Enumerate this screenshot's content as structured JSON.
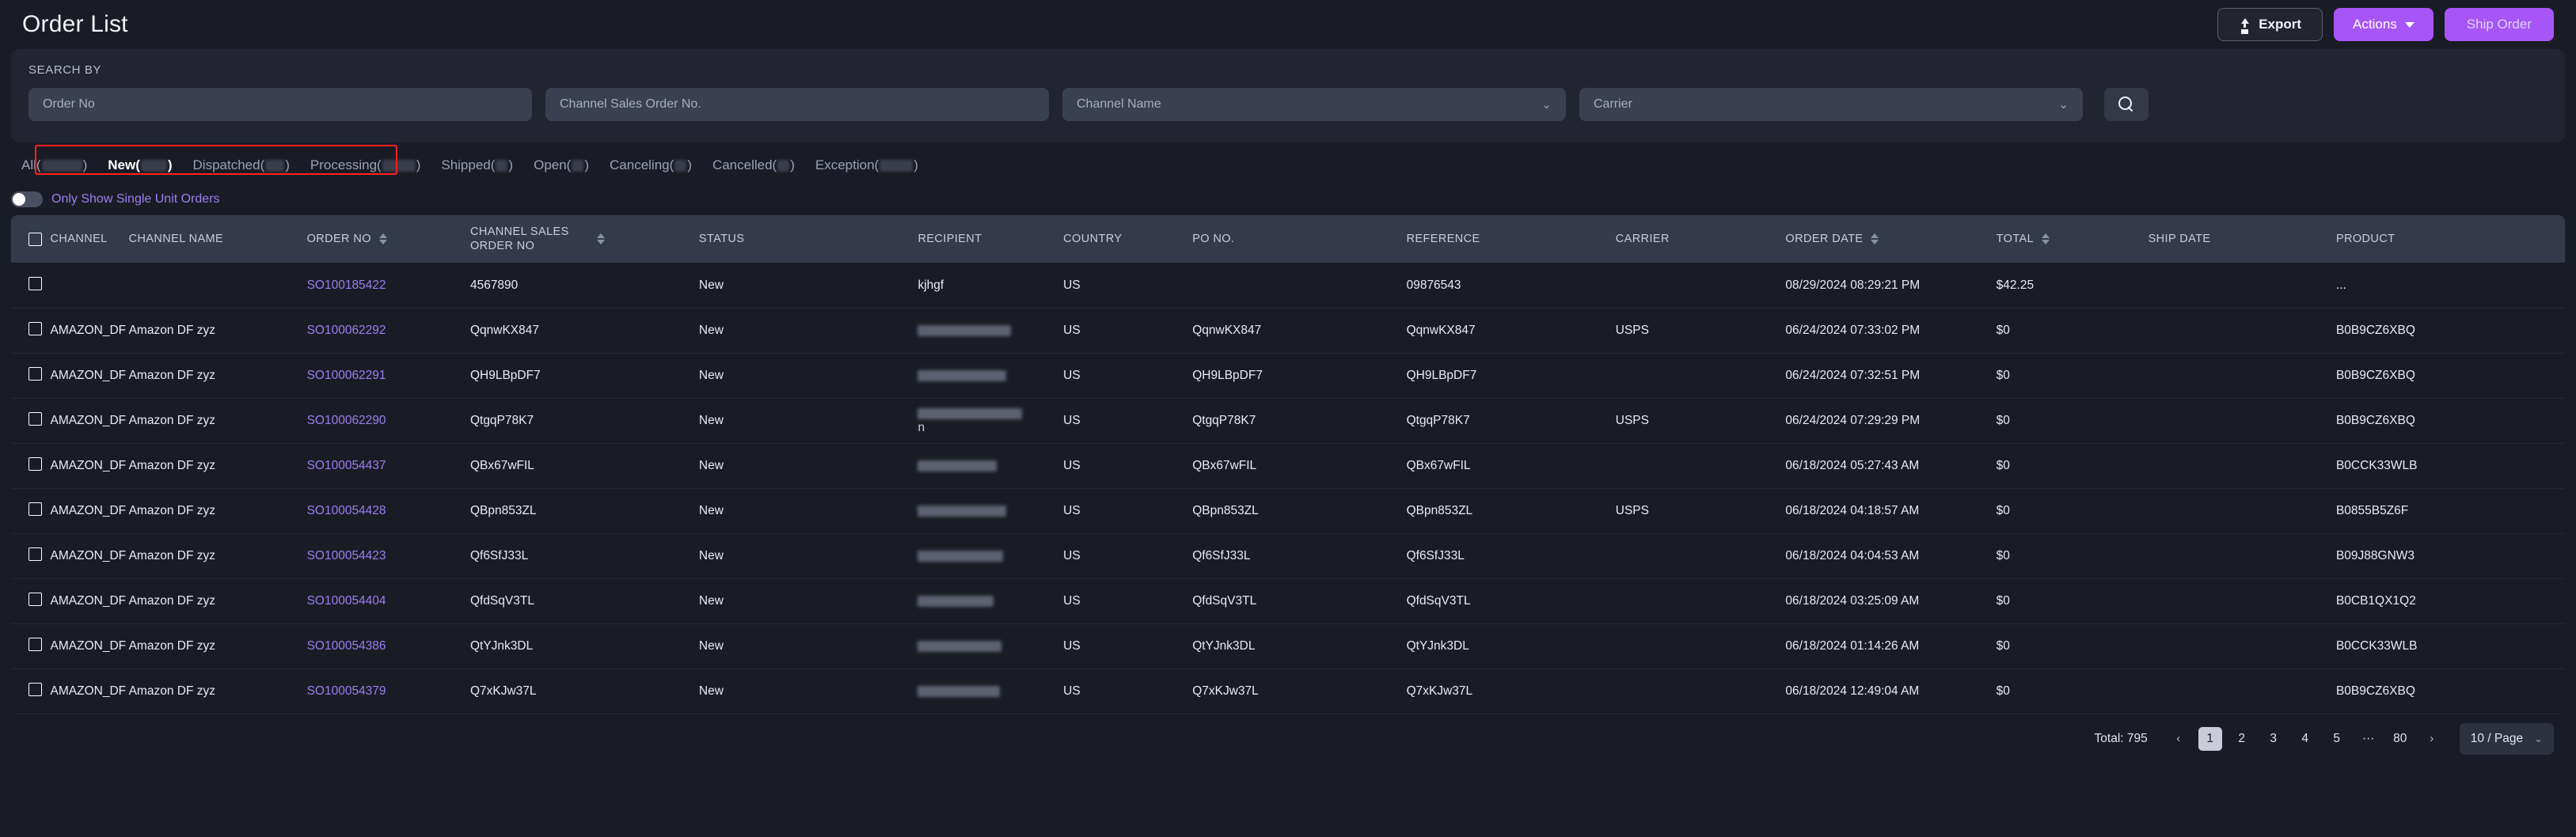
{
  "header": {
    "title": "Order List",
    "export_label": "Export",
    "actions_label": "Actions",
    "ship_label": "Ship Order",
    "export_icon": "upload-icon",
    "actions_icon": "chevron-down-icon"
  },
  "search": {
    "section_label": "SEARCH BY",
    "order_no_placeholder": "Order No",
    "order_no_value": "",
    "channel_sales_order_no_placeholder": "Channel Sales Order No.",
    "channel_sales_order_no_value": "",
    "channel_name_placeholder": "Channel Name",
    "carrier_placeholder": "Carrier",
    "search_icon": "search-icon",
    "chevron": "⌄"
  },
  "tabs": {
    "active": "New",
    "items": [
      {
        "label": "All(",
        "count": "█████",
        "suffix": ")",
        "count_redacted": true,
        "active": false
      },
      {
        "label": "New(",
        "count": "███",
        "suffix": ")",
        "count_redacted": true,
        "active": true
      },
      {
        "label": "Dispatched(",
        "count": "██",
        "suffix": ")",
        "count_redacted": true,
        "active": false
      },
      {
        "label": "Processing(",
        "count": "████",
        "suffix": ")",
        "count_redacted": true,
        "active": false
      },
      {
        "label": "Shipped(",
        "count": "█",
        "suffix": ")",
        "count_redacted": true,
        "active": false
      },
      {
        "label": "Open(",
        "count": "█",
        "suffix": ")",
        "count_redacted": true,
        "active": false
      },
      {
        "label": "Canceling(",
        "count": "█",
        "suffix": ")",
        "count_redacted": true,
        "active": false
      },
      {
        "label": "Cancelled(",
        "count": "█",
        "suffix": ")",
        "count_redacted": true,
        "active": false
      },
      {
        "label": "Exception(",
        "count": "████",
        "suffix": ")",
        "count_redacted": true,
        "active": false
      }
    ],
    "highlight_color": "#fe2020"
  },
  "toggle": {
    "label": "Only Show Single Unit Orders",
    "checked": false
  },
  "table": {
    "columns": [
      {
        "key": "checkbox",
        "label": "",
        "sortable": false
      },
      {
        "key": "channel",
        "label": "CHANNEL",
        "sortable": false
      },
      {
        "key": "cname",
        "label": "CHANNEL NAME",
        "sortable": false
      },
      {
        "key": "order_no",
        "label": "ORDER NO",
        "sortable": true
      },
      {
        "key": "cso_no",
        "label": "CHANNEL SALES ORDER NO",
        "sortable": true
      },
      {
        "key": "status",
        "label": "STATUS",
        "sortable": false
      },
      {
        "key": "recipient",
        "label": "RECIPIENT",
        "sortable": false
      },
      {
        "key": "country",
        "label": "COUNTRY",
        "sortable": false
      },
      {
        "key": "po_no",
        "label": "PO NO.",
        "sortable": false
      },
      {
        "key": "reference",
        "label": "REFERENCE",
        "sortable": false
      },
      {
        "key": "carrier",
        "label": "CARRIER",
        "sortable": false
      },
      {
        "key": "order_date",
        "label": "ORDER DATE",
        "sortable": true
      },
      {
        "key": "total",
        "label": "TOTAL",
        "sortable": true
      },
      {
        "key": "ship_date",
        "label": "SHIP DATE",
        "sortable": false
      },
      {
        "key": "product",
        "label": "PRODUCT",
        "sortable": false
      }
    ],
    "rows": [
      {
        "selected": false,
        "channel": "",
        "cname": "",
        "order_no": "SO100185422",
        "cso_no": "4567890",
        "status": "New",
        "recipient": "kjhgf",
        "recipient_redacted": false,
        "country": "US",
        "po_no": "",
        "reference": "09876543",
        "carrier": "",
        "order_date": "08/29/2024 08:29:21 PM",
        "total": "$42.25",
        "ship_date": "",
        "product": "..."
      },
      {
        "selected": false,
        "channel": "AMAZON_DF",
        "cname": "Amazon DF zyz",
        "order_no": "SO100062292",
        "cso_no": "QqnwKX847",
        "status": "New",
        "recipient": "",
        "recipient_redacted": true,
        "country": "US",
        "po_no": "QqnwKX847",
        "reference": "QqnwKX847",
        "carrier": "USPS",
        "order_date": "06/24/2024 07:33:02 PM",
        "total": "$0",
        "ship_date": "",
        "product": "B0B9CZ6XBQ"
      },
      {
        "selected": false,
        "channel": "AMAZON_DF",
        "cname": "Amazon DF zyz",
        "order_no": "SO100062291",
        "cso_no": "QH9LBpDF7",
        "status": "New",
        "recipient": "",
        "recipient_redacted": true,
        "country": "US",
        "po_no": "QH9LBpDF7",
        "reference": "QH9LBpDF7",
        "carrier": "",
        "order_date": "06/24/2024 07:32:51 PM",
        "total": "$0",
        "ship_date": "",
        "product": "B0B9CZ6XBQ"
      },
      {
        "selected": false,
        "channel": "AMAZON_DF",
        "cname": "Amazon DF zyz",
        "order_no": "SO100062290",
        "cso_no": "QtgqP78K7",
        "status": "New",
        "recipient": "n",
        "recipient_redacted": true,
        "country": "US",
        "po_no": "QtgqP78K7",
        "reference": "QtgqP78K7",
        "carrier": "USPS",
        "order_date": "06/24/2024 07:29:29 PM",
        "total": "$0",
        "ship_date": "",
        "product": "B0B9CZ6XBQ"
      },
      {
        "selected": false,
        "channel": "AMAZON_DF",
        "cname": "Amazon DF zyz",
        "order_no": "SO100054437",
        "cso_no": "QBx67wFIL",
        "status": "New",
        "recipient": "",
        "recipient_redacted": true,
        "country": "US",
        "po_no": "QBx67wFIL",
        "reference": "QBx67wFIL",
        "carrier": "",
        "order_date": "06/18/2024 05:27:43 AM",
        "total": "$0",
        "ship_date": "",
        "product": "B0CCK33WLB"
      },
      {
        "selected": false,
        "channel": "AMAZON_DF",
        "cname": "Amazon DF zyz",
        "order_no": "SO100054428",
        "cso_no": "QBpn853ZL",
        "status": "New",
        "recipient": "",
        "recipient_redacted": true,
        "country": "US",
        "po_no": "QBpn853ZL",
        "reference": "QBpn853ZL",
        "carrier": "USPS",
        "order_date": "06/18/2024 04:18:57 AM",
        "total": "$0",
        "ship_date": "",
        "product": "B0855B5Z6F"
      },
      {
        "selected": false,
        "channel": "AMAZON_DF",
        "cname": "Amazon DF zyz",
        "order_no": "SO100054423",
        "cso_no": "Qf6SfJ33L",
        "status": "New",
        "recipient": "",
        "recipient_redacted": true,
        "country": "US",
        "po_no": "Qf6SfJ33L",
        "reference": "Qf6SfJ33L",
        "carrier": "",
        "order_date": "06/18/2024 04:04:53 AM",
        "total": "$0",
        "ship_date": "",
        "product": "B09J88GNW3"
      },
      {
        "selected": false,
        "channel": "AMAZON_DF",
        "cname": "Amazon DF zyz",
        "order_no": "SO100054404",
        "cso_no": "QfdSqV3TL",
        "status": "New",
        "recipient": "",
        "recipient_redacted": true,
        "country": "US",
        "po_no": "QfdSqV3TL",
        "reference": "QfdSqV3TL",
        "carrier": "",
        "order_date": "06/18/2024 03:25:09 AM",
        "total": "$0",
        "ship_date": "",
        "product": "B0CB1QX1Q2"
      },
      {
        "selected": false,
        "channel": "AMAZON_DF",
        "cname": "Amazon DF zyz",
        "order_no": "SO100054386",
        "cso_no": "QtYJnk3DL",
        "status": "New",
        "recipient": "",
        "recipient_redacted": true,
        "country": "US",
        "po_no": "QtYJnk3DL",
        "reference": "QtYJnk3DL",
        "carrier": "",
        "order_date": "06/18/2024 01:14:26 AM",
        "total": "$0",
        "ship_date": "",
        "product": "B0CCK33WLB"
      },
      {
        "selected": false,
        "channel": "AMAZON_DF",
        "cname": "Amazon DF zyz",
        "order_no": "SO100054379",
        "cso_no": "Q7xKJw37L",
        "status": "New",
        "recipient": "",
        "recipient_redacted": true,
        "country": "US",
        "po_no": "Q7xKJw37L",
        "reference": "Q7xKJw37L",
        "carrier": "",
        "order_date": "06/18/2024 12:49:04 AM",
        "total": "$0",
        "ship_date": "",
        "product": "B0B9CZ6XBQ"
      }
    ]
  },
  "pagination": {
    "total_label": "Total: 795",
    "prev_icon": "‹",
    "next_icon": "›",
    "pages": [
      "1",
      "2",
      "3",
      "4",
      "5",
      "···",
      "80"
    ],
    "current_page": "1",
    "page_size_label": "10 / Page",
    "page_size_chevron": "⌄"
  },
  "colors": {
    "accent": "#a855f7",
    "link": "#9b7ef0",
    "page_bg": "#1a1c25",
    "panel_bg": "#22252f",
    "field_bg": "#3a3f52",
    "table_head_bg": "#343a4c",
    "highlight": "#fe2020"
  }
}
